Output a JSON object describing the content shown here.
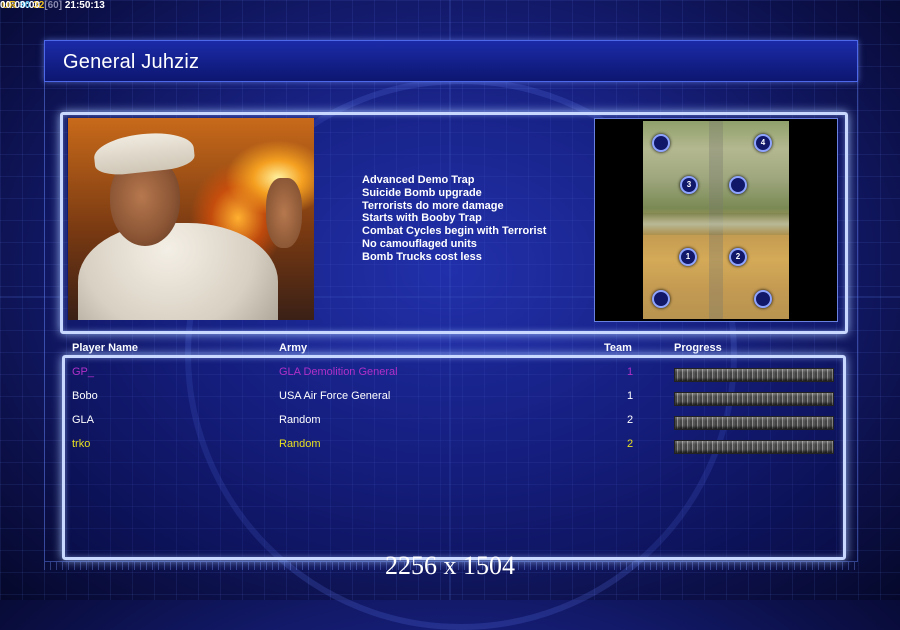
{
  "hud": {
    "ur_label": "UR",
    "value_a": "30",
    "value_b": "32",
    "fps": "[60]",
    "clock": "21:50:13",
    "timer": "00:00:00"
  },
  "title": "General Juhziz",
  "traits": [
    "Advanced Demo Trap",
    "Suicide Bomb upgrade",
    "Terrorists do more damage",
    "Starts with Booby Trap",
    "Combat Cycles begin with Terrorist",
    "No camouflaged units",
    "Bomb Trucks cost less"
  ],
  "minimap": {
    "spots": [
      {
        "label": ""
      },
      {
        "label": "4"
      },
      {
        "label": "3"
      },
      {
        "label": ""
      },
      {
        "label": "1"
      },
      {
        "label": "2"
      },
      {
        "label": ""
      },
      {
        "label": ""
      }
    ]
  },
  "columns": {
    "name": "Player Name",
    "army": "Army",
    "team": "Team",
    "progress": "Progress"
  },
  "players": [
    {
      "name": "GP_",
      "army": "GLA Demolition General",
      "team": "1",
      "color": "#b030c8",
      "progress": 0
    },
    {
      "name": "Bobo",
      "army": "USA Air Force General",
      "team": "1",
      "color": "#ffffff",
      "progress": 0
    },
    {
      "name": "GLA",
      "army": "Random",
      "team": "2",
      "color": "#ffffff",
      "progress": 0
    },
    {
      "name": "trko",
      "army": "Random",
      "team": "2",
      "color": "#e8e020",
      "progress": 0
    }
  ],
  "resolution": "2256 x 1504"
}
